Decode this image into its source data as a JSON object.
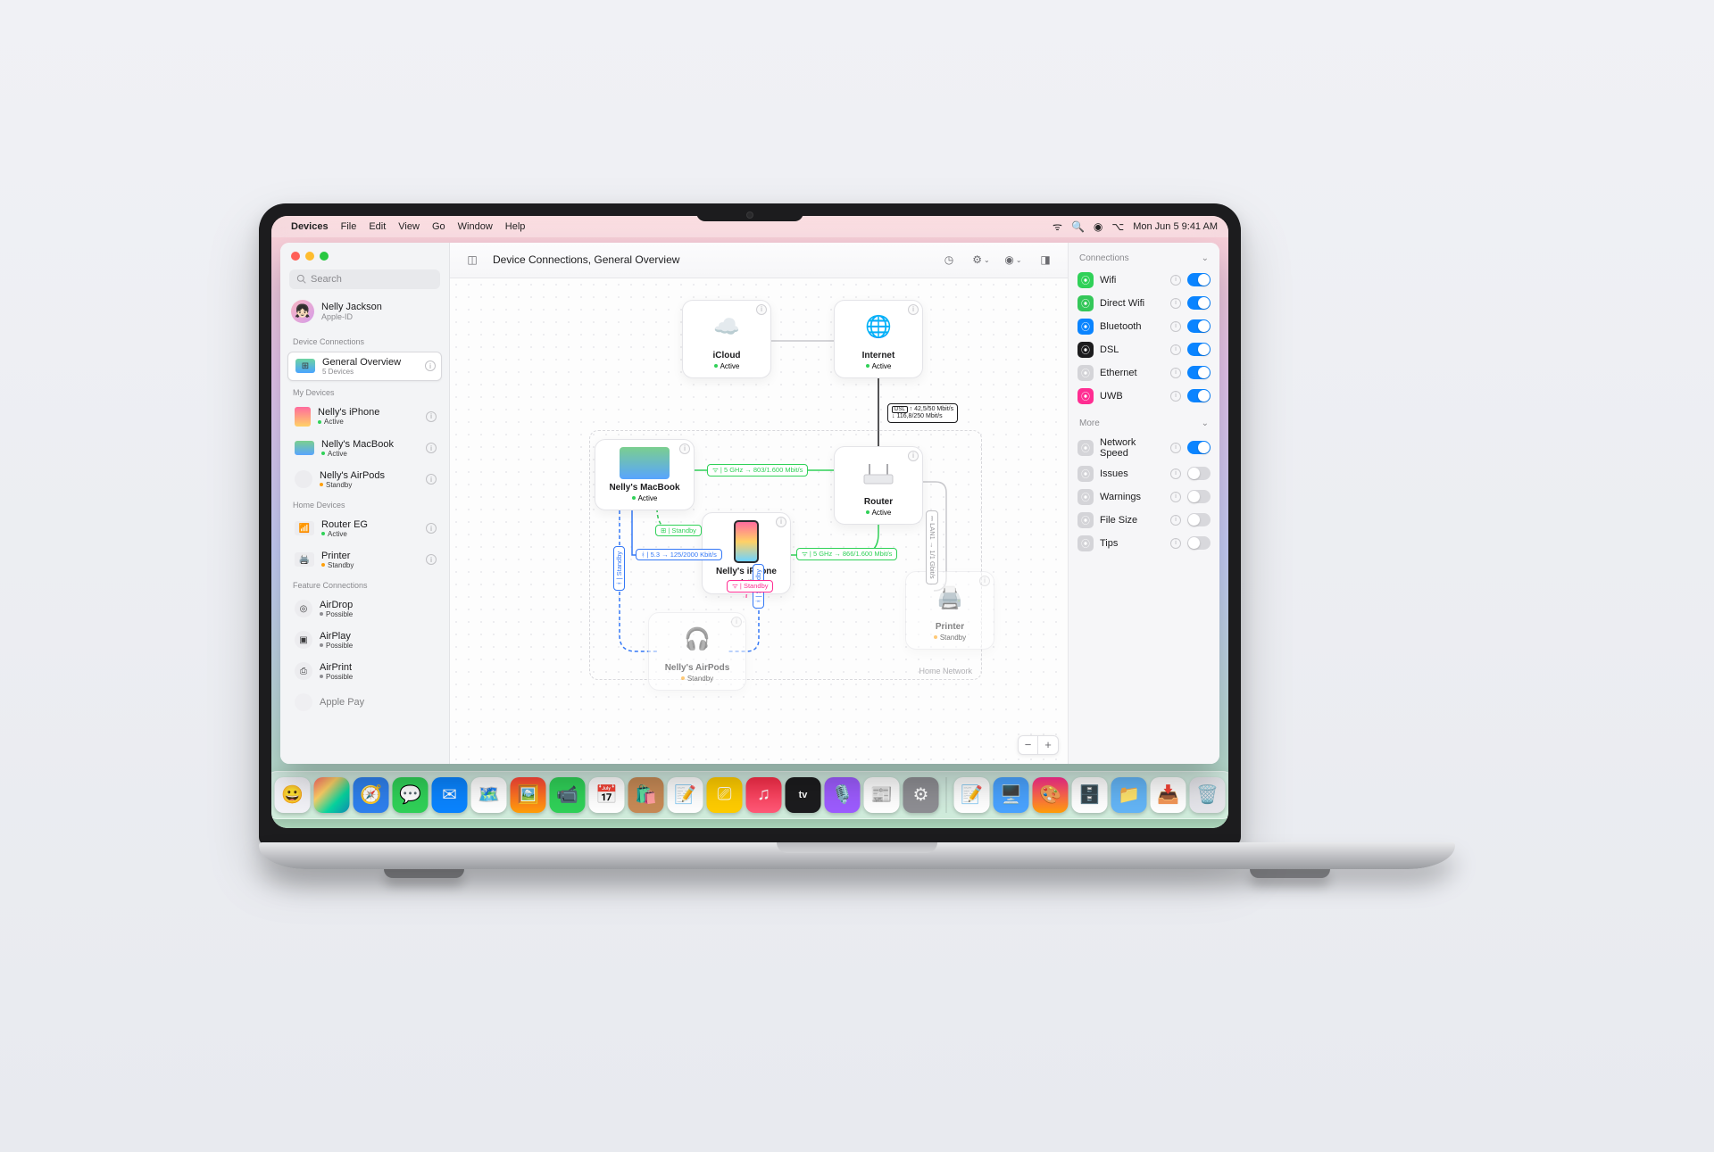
{
  "menubar": {
    "app": "Devices",
    "items": [
      "File",
      "Edit",
      "View",
      "Go",
      "Window",
      "Help"
    ],
    "datetime": "Mon Jun 5  9:41 AM"
  },
  "window": {
    "title": "Device Connections, General Overview"
  },
  "search": {
    "placeholder": "Search"
  },
  "user": {
    "name": "Nelly Jackson",
    "sub": "Apple-ID"
  },
  "sidebar": {
    "sec1": "Device Connections",
    "overview": {
      "title": "General Overview",
      "sub": "5 Devices"
    },
    "sec2": "My Devices",
    "myDevices": [
      {
        "title": "Nelly's iPhone",
        "status": "Active",
        "dot": "dot-green"
      },
      {
        "title": "Nelly's MacBook",
        "status": "Active",
        "dot": "dot-green"
      },
      {
        "title": "Nelly's AirPods",
        "status": "Standby",
        "dot": "dot-orange"
      }
    ],
    "sec3": "Home Devices",
    "homeDevices": [
      {
        "title": "Router EG",
        "status": "Active",
        "dot": "dot-green"
      },
      {
        "title": "Printer",
        "status": "Standby",
        "dot": "dot-orange"
      }
    ],
    "sec4": "Feature Connections",
    "features": [
      {
        "title": "AirDrop",
        "status": "Possible",
        "dot": "dot-gray"
      },
      {
        "title": "AirPlay",
        "status": "Possible",
        "dot": "dot-gray"
      },
      {
        "title": "AirPrint",
        "status": "Possible",
        "dot": "dot-gray"
      }
    ],
    "applePay": "Apple Pay"
  },
  "nodes": {
    "icloud": {
      "title": "iCloud",
      "status": "Active",
      "dot": "dot-green"
    },
    "internet": {
      "title": "Internet",
      "status": "Active",
      "dot": "dot-green"
    },
    "macbook": {
      "title": "Nelly's MacBook",
      "status": "Active",
      "dot": "dot-green"
    },
    "router": {
      "title": "Router",
      "status": "Active",
      "dot": "dot-green"
    },
    "iphone": {
      "title": "Nelly's iPhone",
      "status": "Active",
      "dot": "dot-green"
    },
    "airpods": {
      "title": "Nelly's AirPods",
      "status": "Standby",
      "dot": "dot-orange"
    },
    "printer": {
      "title": "Printer",
      "status": "Standby",
      "dot": "dot-orange"
    }
  },
  "edges": {
    "dsl": "↑ 42,5/50 Mbit/s\n↓ 116,8/250 Mbit/s",
    "mac_router": "ᯤ | 5 GHz → 803/1.600 Mbit/s",
    "iphone_router": "ᯤ | 5 GHz → 866/1.600 Mbit/s",
    "mac_iphone": "ᚼ | 5.3 → 125/2000 Kbit/s",
    "mac_airpods": "ᚼ | Standby",
    "iphone_airpods": "ᚼ | Standby",
    "mac_iphone_wifi": "⊞ | Standby",
    "iphone_printer": "ᯤ | Standby",
    "router_printer": "⎓ LAN1 → 1/1 Gbit/s"
  },
  "homeNetworkLabel": "Home Network",
  "inspector": {
    "sec1": "Connections",
    "connections": [
      {
        "label": "Wifi",
        "color": "#30d158",
        "on": true
      },
      {
        "label": "Direct Wifi",
        "color": "#34c759",
        "on": true
      },
      {
        "label": "Bluetooth",
        "color": "#0a84ff",
        "on": true
      },
      {
        "label": "DSL",
        "color": "#1c1c1e",
        "on": true
      },
      {
        "label": "Ethernet",
        "color": "#d4d4d8",
        "on": true
      },
      {
        "label": "UWB",
        "color": "#ff2d92",
        "on": true
      }
    ],
    "sec2": "More",
    "more": [
      {
        "label": "Network Speed",
        "on": true,
        "color": "#d4d4d8"
      },
      {
        "label": "Issues",
        "on": false,
        "color": "#d4d4d8"
      },
      {
        "label": "Warnings",
        "on": false,
        "color": "#d4d4d8"
      },
      {
        "label": "File Size",
        "on": false,
        "color": "#d4d4d8"
      },
      {
        "label": "Tips",
        "on": false,
        "color": "#d4d4d8"
      }
    ]
  },
  "dockApps": [
    {
      "c": "#f2f2f7",
      "g": "😀"
    },
    {
      "c": "linear-gradient(135deg,#ff6b6b,#ffd166,#06d6a0,#118ab2)",
      "g": ""
    },
    {
      "c": "#2f80ed",
      "g": "🧭"
    },
    {
      "c": "#30d158",
      "g": "💬"
    },
    {
      "c": "#0a84ff",
      "g": "✉︎"
    },
    {
      "c": "#ffffff",
      "g": "🗺️"
    },
    {
      "c": "linear-gradient(#ff453a,#ff9f0a)",
      "g": "🖼️"
    },
    {
      "c": "#30d158",
      "g": "📹"
    },
    {
      "c": "#ffffff",
      "g": "📅"
    },
    {
      "c": "#c78a56",
      "g": "🛍️"
    },
    {
      "c": "#ffffff",
      "g": "📝"
    },
    {
      "c": "#ffcc00",
      "g": "⎚"
    },
    {
      "c": "linear-gradient(#fa2d48,#ff5a78)",
      "g": "♫"
    },
    {
      "c": "#1c1c1e",
      "g": "tv"
    },
    {
      "c": "#9d5cff",
      "g": "🎙️"
    },
    {
      "c": "#ffffff",
      "g": "📰"
    },
    {
      "c": "#8e8e93",
      "g": "⚙︎"
    }
  ],
  "dockApps2": [
    {
      "c": "#ffffff",
      "g": "📝"
    },
    {
      "c": "#4aa3ff",
      "g": "🖥️"
    },
    {
      "c": "linear-gradient(#ff2d92,#ff9f0a)",
      "g": "🎨"
    },
    {
      "c": "#ffffff",
      "g": "🗄️"
    },
    {
      "c": "#64b5f6",
      "g": "📁"
    },
    {
      "c": "#ffffff",
      "g": "📥"
    },
    {
      "c": "#e5e5ea",
      "g": "🗑️"
    }
  ]
}
